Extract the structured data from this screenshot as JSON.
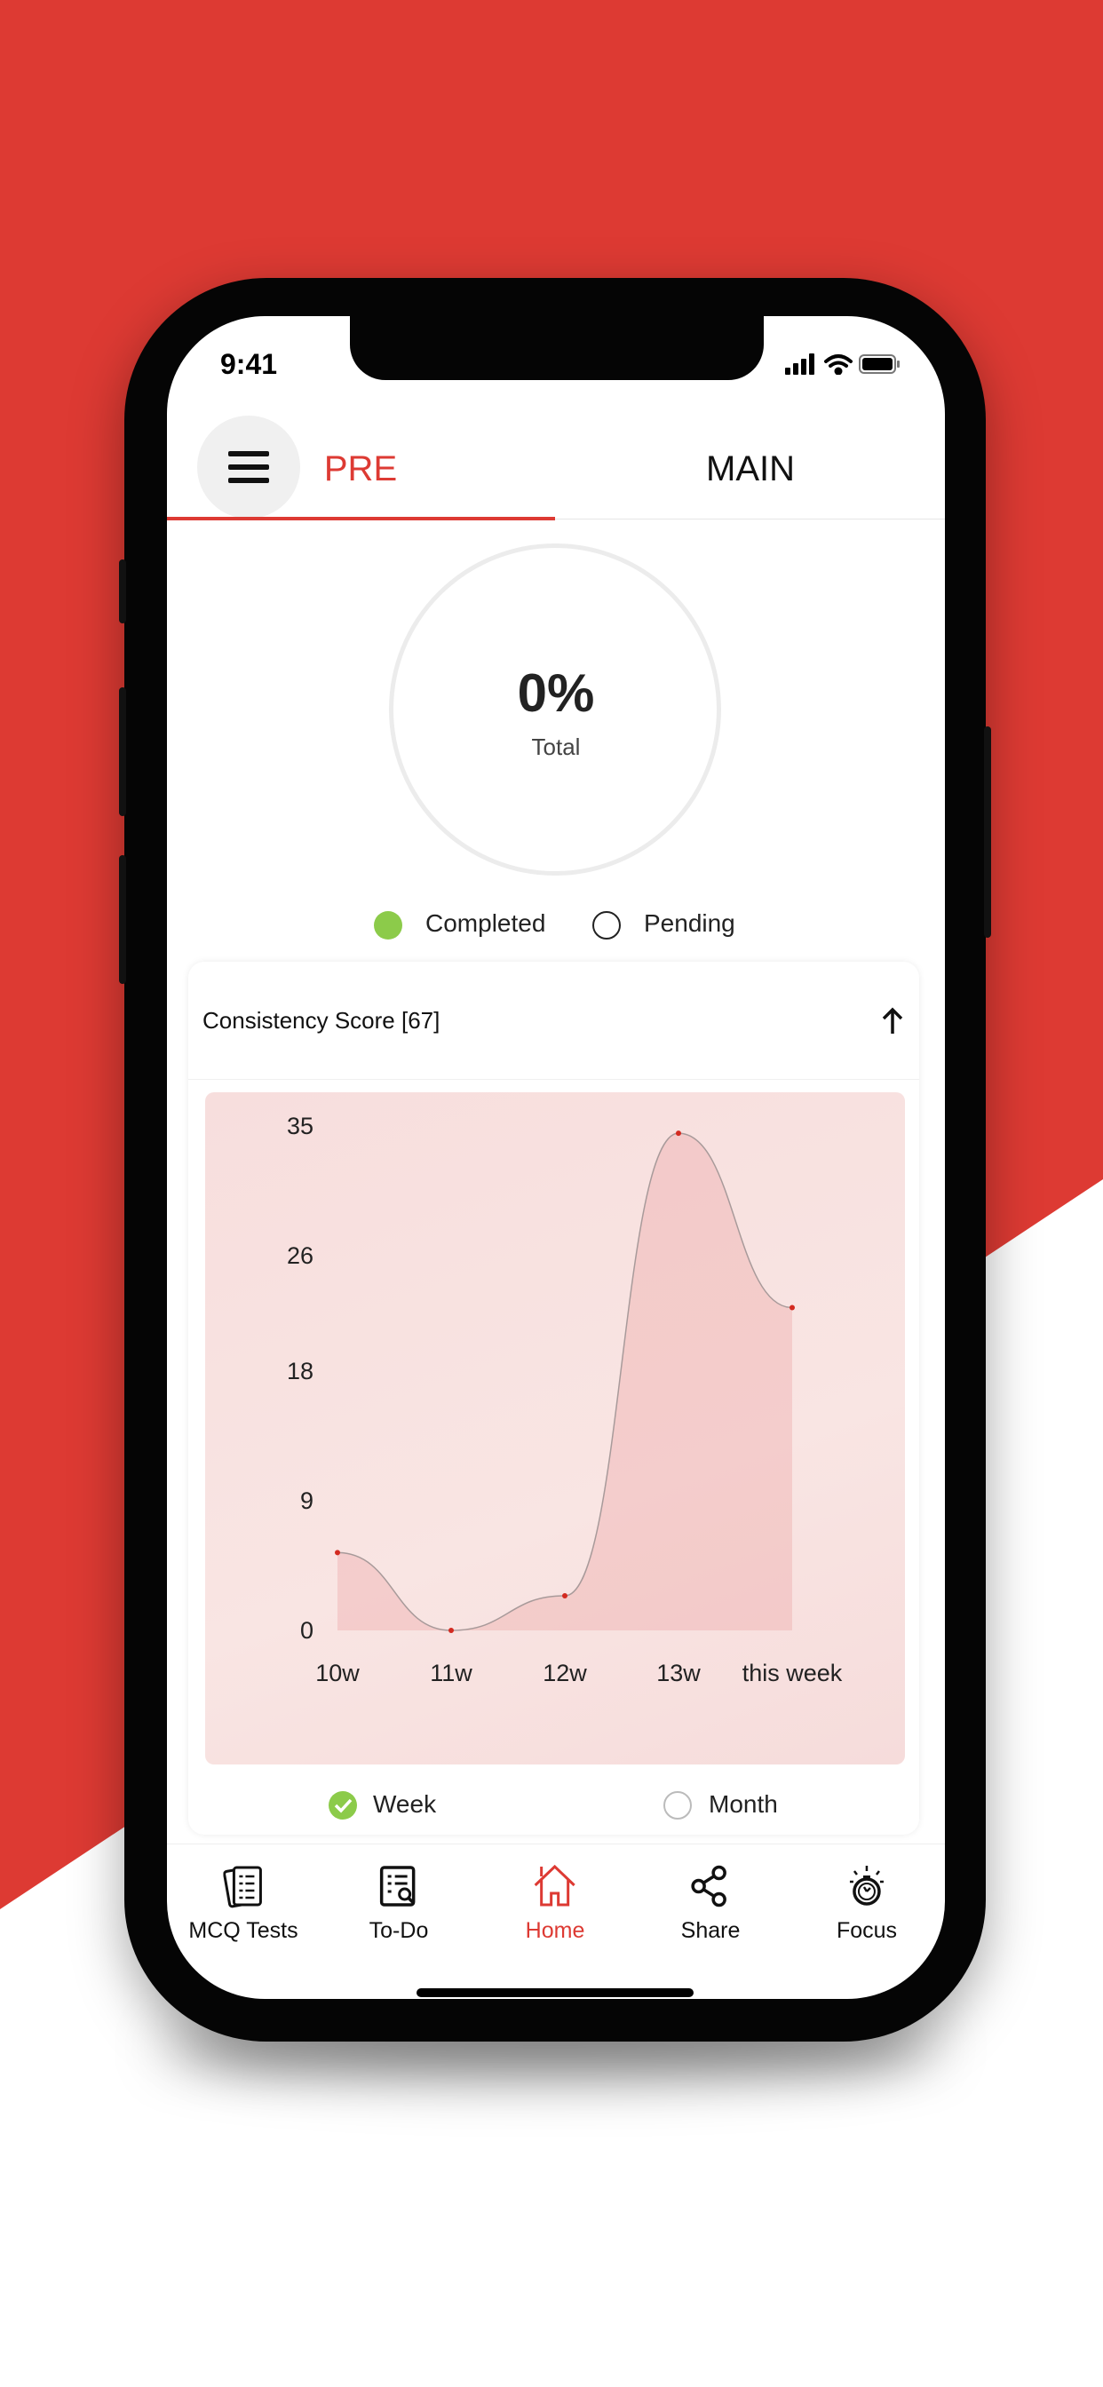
{
  "status_bar": {
    "time": "9:41"
  },
  "header": {
    "menu_icon": "hamburger-icon",
    "tabs": [
      {
        "label": "PRE",
        "active": true
      },
      {
        "label": "MAIN",
        "active": false
      }
    ]
  },
  "progress": {
    "value": "0%",
    "label": "Total"
  },
  "legend": {
    "completed": "Completed",
    "pending": "Pending",
    "completed_color": "#8CCB4A"
  },
  "consistency": {
    "title": "Consistency Score [67]",
    "toggle_icon": "arrow-up-icon"
  },
  "chart_data": {
    "type": "area",
    "categories": [
      "10w",
      "11w",
      "12w",
      "13w",
      "this week"
    ],
    "values": [
      5.4,
      0,
      2.4,
      34.5,
      22.4
    ],
    "yticks": [
      0,
      9,
      18,
      26,
      35
    ],
    "ylim": [
      0,
      35
    ],
    "grid": false,
    "title": "",
    "xlabel": "",
    "ylabel": ""
  },
  "period": {
    "options": [
      {
        "label": "Week",
        "selected": true
      },
      {
        "label": "Month",
        "selected": false
      }
    ]
  },
  "tabbar": {
    "items": [
      {
        "label": "MCQ Tests",
        "icon": "test-papers-icon",
        "active": false
      },
      {
        "label": "To-Do",
        "icon": "todo-list-icon",
        "active": false
      },
      {
        "label": "Home",
        "icon": "home-icon",
        "active": true
      },
      {
        "label": "Share",
        "icon": "share-icon",
        "active": false
      },
      {
        "label": "Focus",
        "icon": "stopwatch-icon",
        "active": false
      }
    ]
  },
  "colors": {
    "accent": "#DD3A33",
    "background_red": "#DD3A33"
  }
}
